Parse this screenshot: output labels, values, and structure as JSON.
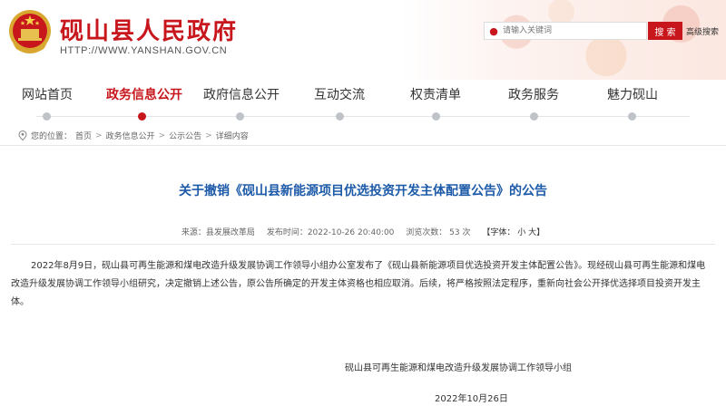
{
  "header": {
    "site_title": "砚山县人民政府",
    "site_url": "HTTP://WWW.YANSHAN.GOV.CN",
    "search_placeholder": "请输入关键词",
    "search_button": "搜 索",
    "advanced_search": "高级搜索",
    "accent_color": "#c8161d"
  },
  "nav": {
    "items": [
      {
        "label": "网站首页"
      },
      {
        "label": "政务信息公开",
        "active": true
      },
      {
        "label": "政府信息公开"
      },
      {
        "label": "互动交流"
      },
      {
        "label": "权责清单"
      },
      {
        "label": "政务服务"
      },
      {
        "label": "魅力砚山"
      }
    ]
  },
  "breadcrumb": {
    "prefix": "您的位置：",
    "items": [
      "首页",
      "政务信息公开",
      "公示公告",
      "详细内容"
    ]
  },
  "article": {
    "title": "关于撤销《砚山县新能源项目优选投资开发主体配置公告》的公告",
    "meta": {
      "source": "来源：县发展改革局",
      "published": "发布时间：2022-10-26 20:40:00",
      "views": "浏览次数： 53  次",
      "font_size": "【字体： 小 大】"
    },
    "body": "2022年8月9日，砚山县可再生能源和煤电改造升级发展协调工作领导小组办公室发布了《砚山县新能源项目优选投资开发主体配置公告》。现经砚山县可再生能源和煤电改造升级发展协调工作领导小组研究，决定撤销上述公告，原公告所确定的开发主体资格也相应取消。后续，将严格按照法定程序，重新向社会公开择优选择项目投资开发主体。",
    "signature": "砚山县可再生能源和煤电改造升级发展协调工作领导小组",
    "date": "2022年10月26日",
    "title_color": "#1d5aa8"
  }
}
